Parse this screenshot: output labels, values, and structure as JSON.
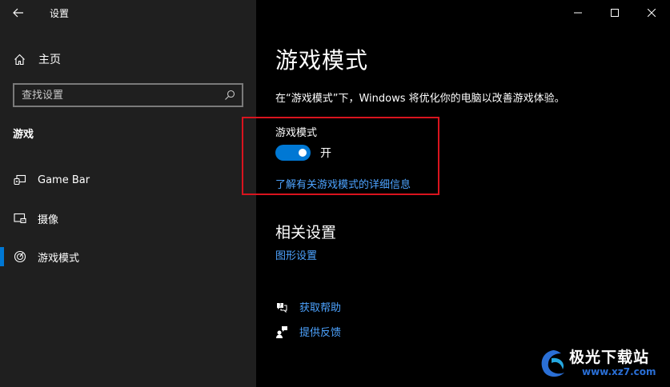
{
  "app": {
    "title": "设置"
  },
  "sidebar": {
    "home_label": "主页",
    "search_placeholder": "查找设置",
    "section_title": "游戏",
    "items": [
      {
        "label": "Game Bar",
        "icon": "game-bar-icon"
      },
      {
        "label": "摄像",
        "icon": "capture-icon"
      },
      {
        "label": "游戏模式",
        "icon": "game-mode-icon",
        "active": true
      }
    ]
  },
  "main": {
    "title": "游戏模式",
    "description": "在“游戏模式”下，Windows 将优化你的电脑以改善游戏体验。",
    "toggle": {
      "heading": "游戏模式",
      "state": "开",
      "on": true
    },
    "learn_more": "了解有关游戏模式的详细信息",
    "related_title": "相关设置",
    "related_link": "图形设置",
    "help": [
      {
        "label": "获取帮助",
        "icon": "get-help-icon"
      },
      {
        "label": "提供反馈",
        "icon": "feedback-icon"
      }
    ]
  },
  "watermark": {
    "text": "极光下载站",
    "url": "www.xz7.com"
  },
  "colors": {
    "accent": "#0078d4",
    "link": "#4da3ff",
    "highlight": "#d9141e",
    "sidebar_bg": "#1f1f1f",
    "main_bg": "#000000"
  }
}
